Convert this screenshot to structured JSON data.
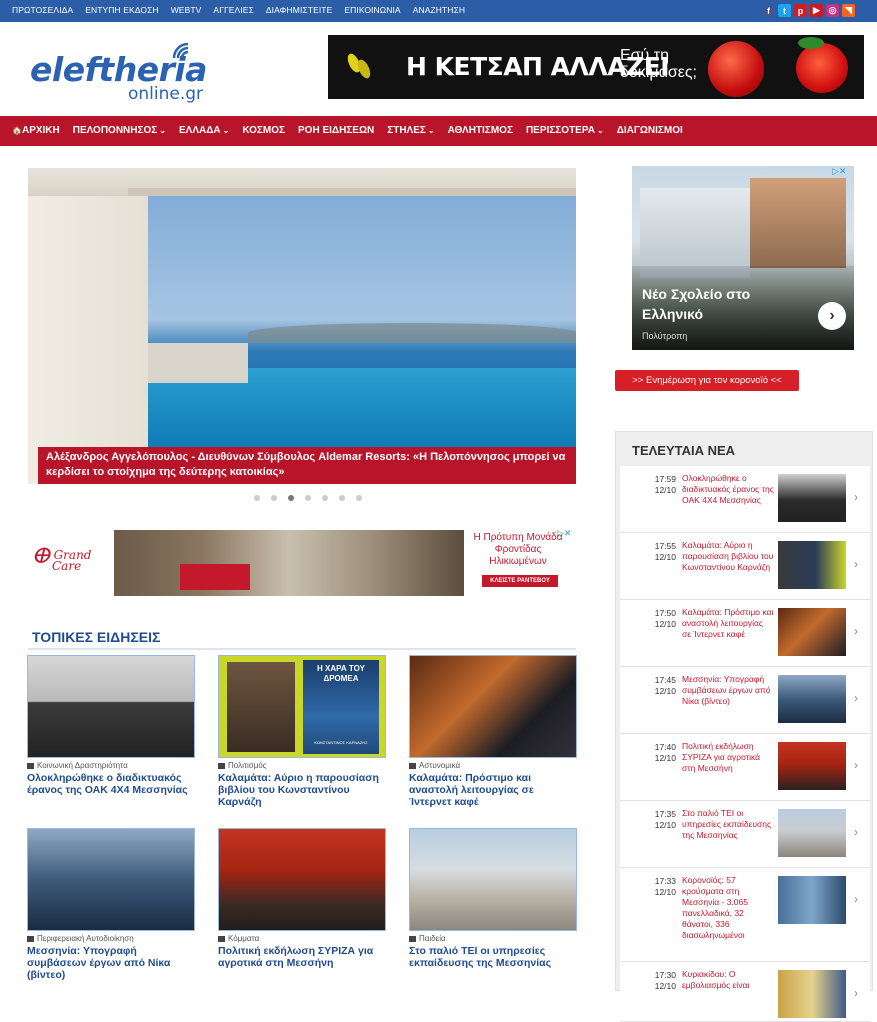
{
  "topnav": [
    "ΠΡΩΤΟΣΕΛΙΔΑ",
    "ΕΝΤΥΠΗ ΕΚΔΟΣΗ",
    "WEBTV",
    "ΑΓΓΕΛΙΕΣ",
    "ΔΙΑΦΗΜΙΣΤΕΙΤΕ",
    "ΕΠΙΚΟΙΝΩΝΙΑ",
    "ΑΝΑΖΗΤΗΣΗ"
  ],
  "social": [
    {
      "icon": "facebook-icon",
      "glyph": "f",
      "color": "#3b5998"
    },
    {
      "icon": "twitter-icon",
      "glyph": "t",
      "color": "#1da1f2"
    },
    {
      "icon": "pinterest-icon",
      "glyph": "p",
      "color": "#cb2027"
    },
    {
      "icon": "youtube-icon",
      "glyph": "▶",
      "color": "#cc181e"
    },
    {
      "icon": "instagram-icon",
      "glyph": "◎",
      "color": "#c13584"
    },
    {
      "icon": "rss-icon",
      "glyph": "◥",
      "color": "#f26522"
    }
  ],
  "logo": {
    "main": "eleftheria",
    "sub": "online.gr"
  },
  "header_ad": {
    "title": "Η ΚΕΤΣΑΠ ΑΛΛΑΖΕΙ",
    "sub1": "Εσύ τη",
    "sub2": "δοκίμασες;"
  },
  "mainnav": [
    {
      "label": "ΑΡΧΙΚΗ",
      "home": true
    },
    {
      "label": "ΠΕΛΟΠΟΝΝΗΣΟΣ",
      "dropdown": true
    },
    {
      "label": "ΕΛΛΑΔΑ",
      "dropdown": true
    },
    {
      "label": "ΚΟΣΜΟΣ"
    },
    {
      "label": "ΡΟΗ ΕΙΔΗΣΕΩΝ"
    },
    {
      "label": "ΣΤΗΛΕΣ",
      "dropdown": true
    },
    {
      "label": "ΑΘΛΗΤΙΣΜΟΣ"
    },
    {
      "label": "ΠΕΡΙΣΣΟΤΕΡΑ",
      "dropdown": true
    },
    {
      "label": "ΔΙΑΓΩΝΙΣΜΟΙ"
    }
  ],
  "hero": {
    "caption": "Αλέξανδρος Αγγελόπουλος - Διευθύνων Σύμβουλος Aldemar Resorts: «Η Πελοπόννησος μπορεί να κερδίσει το στοίχημα της δεύτερης κατοικίας»"
  },
  "slider": {
    "count": 7,
    "active": 3
  },
  "mid_ad": {
    "brand1": "Grand",
    "brand2": "Care",
    "text": "Η Πρότυπη Μονάδα Φροντίδας Ηλικιωμένων",
    "button": "ΚΛΕΙΣΤΕ ΡΑΝΤΕΒΟΥ"
  },
  "section_title": "ΤΟΠΙΚΕΣ ΕΙΔΗΣΕΙΣ",
  "cards": [
    {
      "category": "Κοινωνική Δραστηριότητα",
      "title": "Ολοκληρώθηκε ο διαδικτυακός έρανος της ΟΑΚ 4Χ4 Μεσσηνίας",
      "thumb_bg": "linear-gradient(#d7d7d7,#b9b9b9 45%,#3b3b3b 46%,#222)"
    },
    {
      "category": "Πολιτισμός",
      "title": "Καλαμάτα: Αύριο η παρουσίαση βιβλίου του Κωνσταντίνου Καρνάζη",
      "thumb_bg": "#c9d62a",
      "book_title": "Η ΧΑΡΑ ΤΟΥ ΔΡΟΜΕΑ",
      "book_author": "ΚΩΝΣΤΑΝΤΙΝΟΣ ΚΑΡΝΑΖΗΣ"
    },
    {
      "category": "Αστυνομικά",
      "title": "Καλαμάτα: Πρόστιμο και αναστολή λειτουργίας σε Ίντερνετ καφέ",
      "thumb_bg": "linear-gradient(135deg,#5a2a14,#c26a2c 40%,#1d1d24 70%,#33303a)"
    },
    {
      "category": "Περιφερειακή Αυτοδιοίκηση",
      "title": "Μεσσηνία: Υπογραφή συμβάσεων έργων από Νίκα (βίντεο)",
      "thumb_bg": "linear-gradient(#8fa9c4,#3d5b7a 50%,#1a2c44)"
    },
    {
      "category": "Κόμματα",
      "title": "Πολιτική εκδήλωση ΣΥΡΙΖΑ για αγροτικά στη Μεσσήνη",
      "thumb_bg": "linear-gradient(#c23520,#a72412 40%,#3a2a24 75%,#221d1c)"
    },
    {
      "category": "Παιδεία",
      "title": "Στο παλιό ΤΕΙ οι υπηρεσίες εκπαίδευσης της Μεσσηνίας",
      "thumb_bg": "linear-gradient(#b9cde0,#d7dde2 40%,#b8b0a4 70%,#8c867d)"
    }
  ],
  "side_ad": {
    "title_line1": "Νέο Σχολείο στο",
    "title_line2": "Ελληνικό",
    "source": "Πολύτροπη"
  },
  "covid_button": ">> Ενημέρωση για τον κορονοϊό <<",
  "latest": {
    "heading": "ΤΕΛΕΥΤΑΙΑ ΝΕΑ",
    "items": [
      {
        "time": "17:59",
        "date": "12/10",
        "title": "Ολοκληρώθηκε ο διαδικτυακός έρανος της ΟΑΚ 4Χ4 Μεσσηνίας",
        "img_bg": "linear-gradient(#d0d0d0,#2a2a2a 55%,#222)"
      },
      {
        "time": "17:55",
        "date": "12/10",
        "title": "Καλαμάτα: Αύριο η παρουσίαση βιβλίου του Κωνσταντίνου Καρνάζη",
        "img_bg": "linear-gradient(90deg,#3a3a3a,#2a3c5a 55%,#c9d62a)"
      },
      {
        "time": "17:50",
        "date": "12/10",
        "title": "Καλαμάτα: Πρόστιμο και αναστολή λειτουργίας σε Ίντερνετ καφέ",
        "img_bg": "linear-gradient(135deg,#5a2a14,#c26a2c 45%,#1d1d24)"
      },
      {
        "time": "17:45",
        "date": "12/10",
        "title": "Μεσσηνία: Υπογραφή συμβάσεων έργων από Νίκα (βίντεο)",
        "img_bg": "linear-gradient(#8fa9c4,#3d5b7a 50%,#1a2c44)"
      },
      {
        "time": "17:40",
        "date": "12/10",
        "title": "Πολιτική εκδήλωση ΣΥΡΙΖΑ για αγροτικά στη Μεσσήνη",
        "img_bg": "linear-gradient(#c23520,#a72412 45%,#2a2220)"
      },
      {
        "time": "17:35",
        "date": "12/10",
        "title": "Στο παλιό ΤΕΙ οι υπηρεσίες εκπαίδευσης της Μεσσηνίας",
        "img_bg": "linear-gradient(#b9cde0,#c9cdd0 45%,#8c867d)"
      },
      {
        "time": "17:33",
        "date": "12/10",
        "title": "Κορονοϊός: 57 κρούσματα στη Μεσσηνία - 3.065 πανελλαδικά, 32 θάνατοι, 336 διασωληνωμένοι",
        "img_bg": "linear-gradient(90deg,#4a6e98,#7fa6c8 50%,#2a4a6e)"
      },
      {
        "time": "17:30",
        "date": "12/10",
        "title": "Κυριακίδου: Ο εμβολιασμός είναι",
        "img_bg": "linear-gradient(90deg,#c9a24a,#e6d28c 50%,#3c5a8a)"
      }
    ]
  }
}
